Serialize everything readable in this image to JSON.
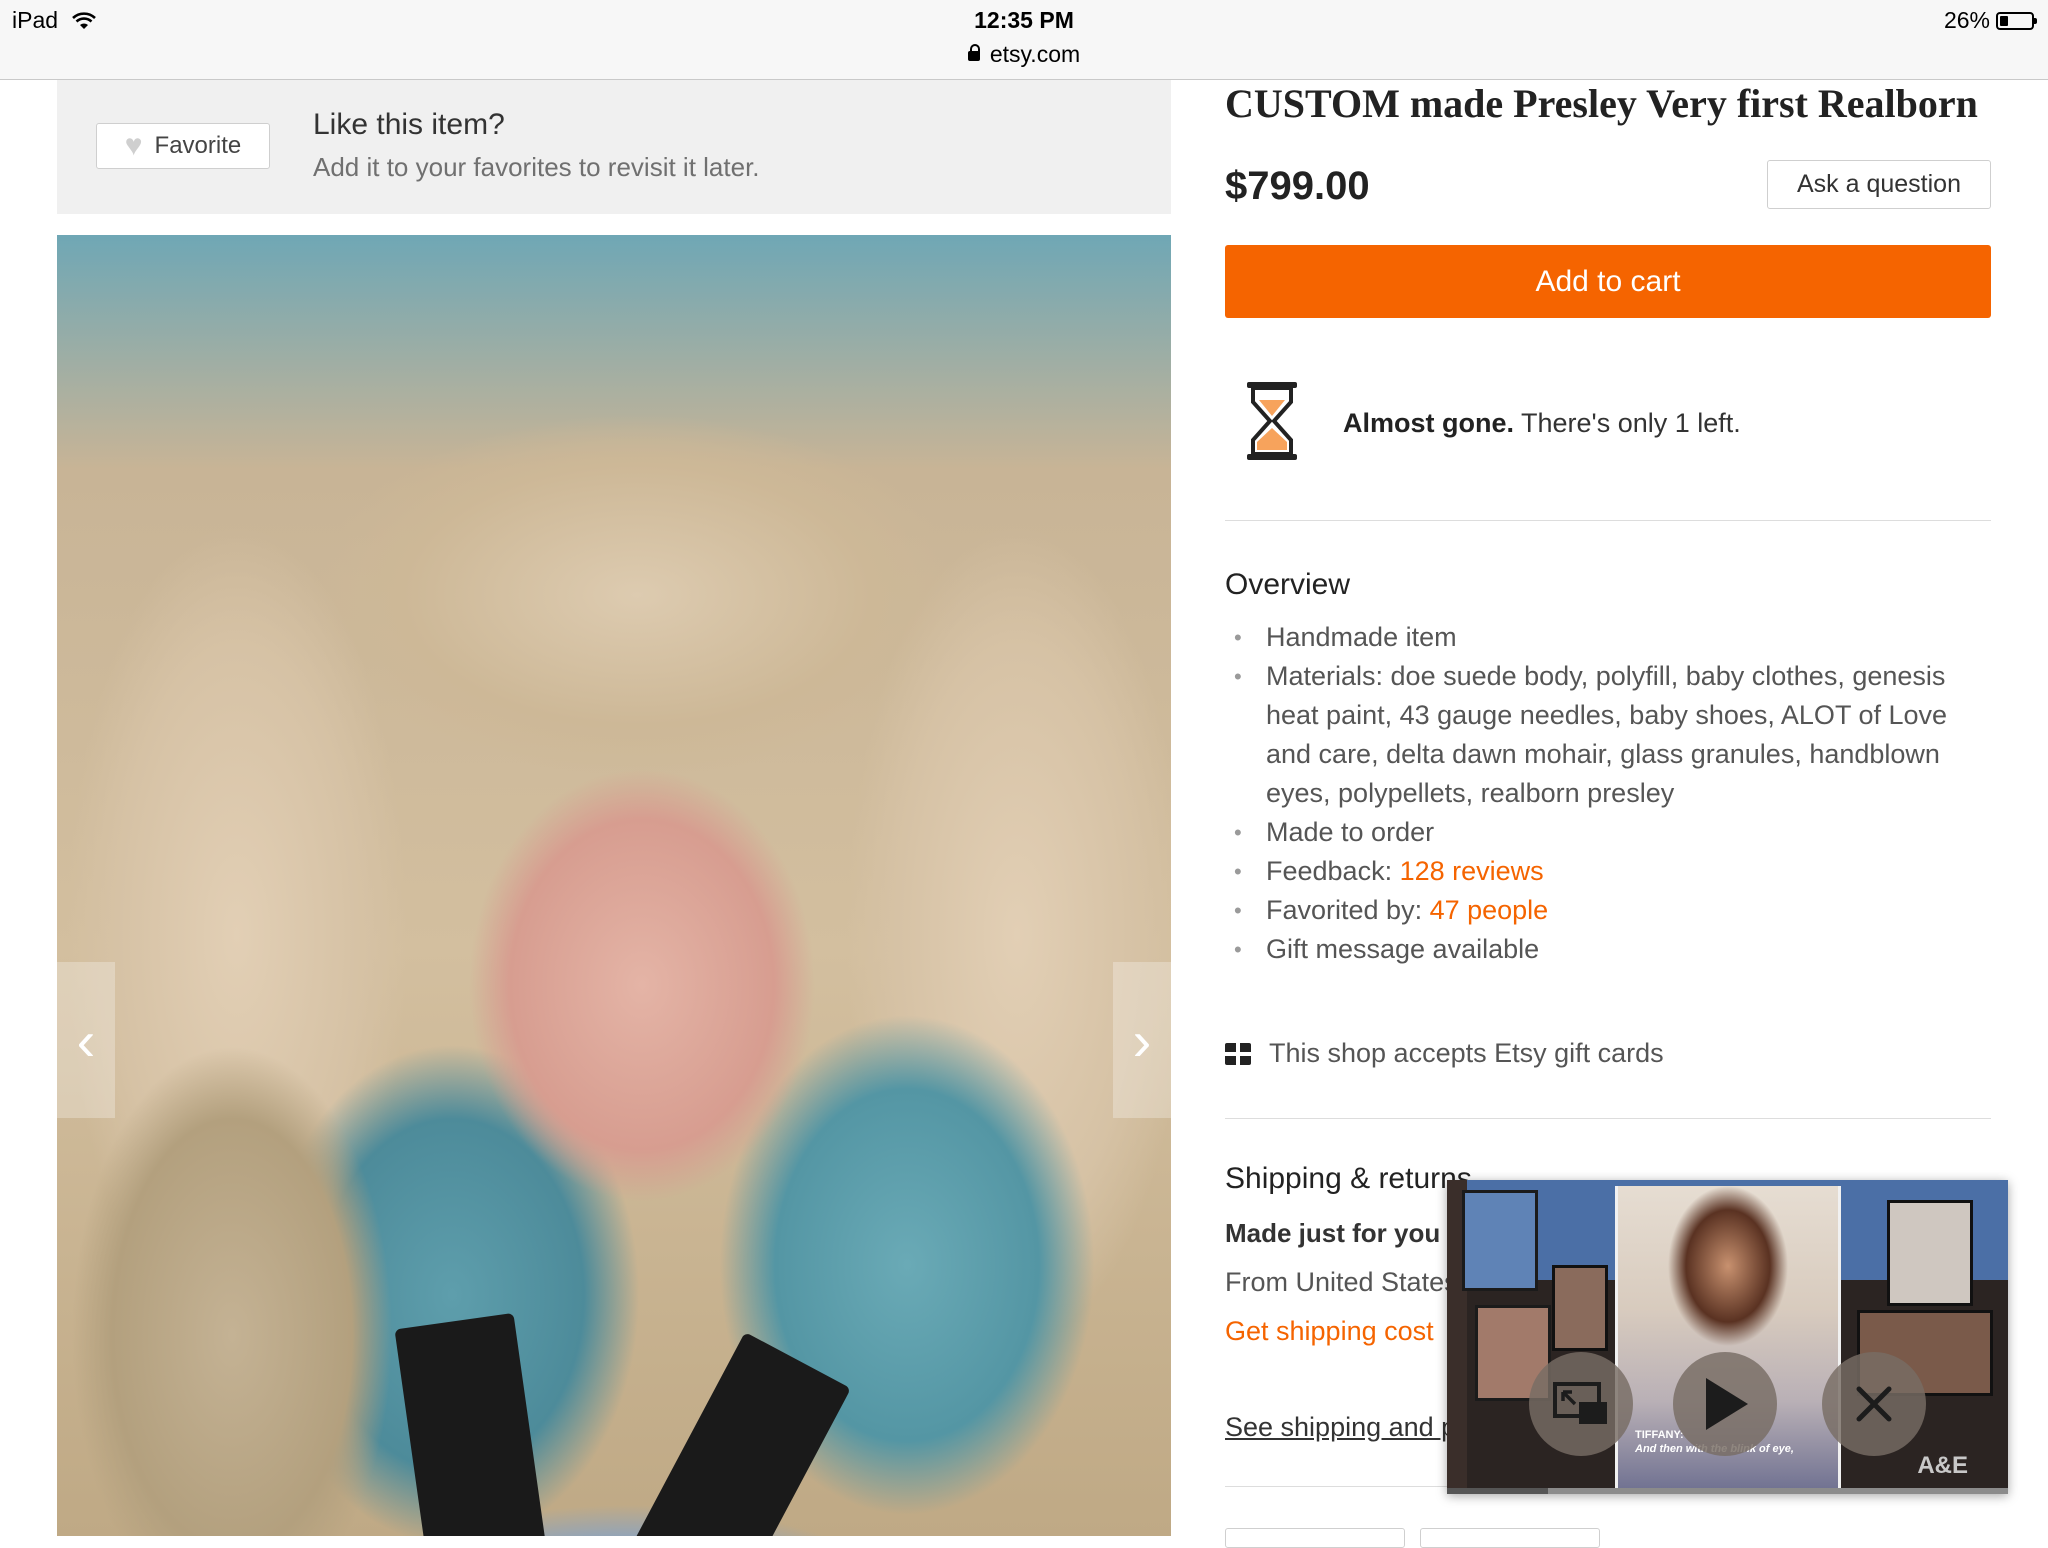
{
  "status_bar": {
    "device": "iPad",
    "time": "12:35 PM",
    "url": "etsy.com",
    "battery": "26%",
    "battery_level": 0.26
  },
  "favorite_box": {
    "button_label": "Favorite",
    "title": "Like this item?",
    "subtitle": "Add it to your favorites to revisit it later."
  },
  "listing": {
    "title": "CUSTOM made Presley Very first Realborn",
    "price": "$799.00",
    "ask_button": "Ask a question",
    "cart_button": "Add to cart",
    "stock_bold": "Almost gone.",
    "stock_text": " There's only 1 left."
  },
  "overview": {
    "heading": "Overview",
    "items": [
      "Handmade item",
      "Materials: doe suede body, polyfill, baby clothes, genesis heat paint, 43 gauge needles, baby shoes, ALOT of Love and care, delta dawn mohair, glass granules, handblown eyes, polypellets, realborn presley",
      "Made to order"
    ],
    "feedback_label": "Feedback: ",
    "feedback_link": "128 reviews",
    "favorited_label": "Favorited by: ",
    "favorited_link": "47 people",
    "gift_message": "Gift message available",
    "gift_cards": "This shop accepts Etsy gift cards"
  },
  "shipping": {
    "heading": "Shipping & returns",
    "subheading": "Made just for you",
    "from": "From United States",
    "cost_link": "Get shipping cost",
    "policies_link": "See shipping and policies"
  },
  "pip_video": {
    "caption_name": "TIFFANY:",
    "caption_line": "And then with the blink of eye,",
    "network_logo": "A&E",
    "progress": 0.18
  },
  "icons": {
    "wifi": "wifi-icon",
    "lock": "lock-icon",
    "heart": "heart-icon",
    "hourglass": "hourglass-icon",
    "gift": "gift-card-icon",
    "prev": "chevron-left-icon",
    "next": "chevron-right-icon"
  },
  "colors": {
    "accent": "#f56400",
    "hourglass_sand": "#f7a35c"
  }
}
